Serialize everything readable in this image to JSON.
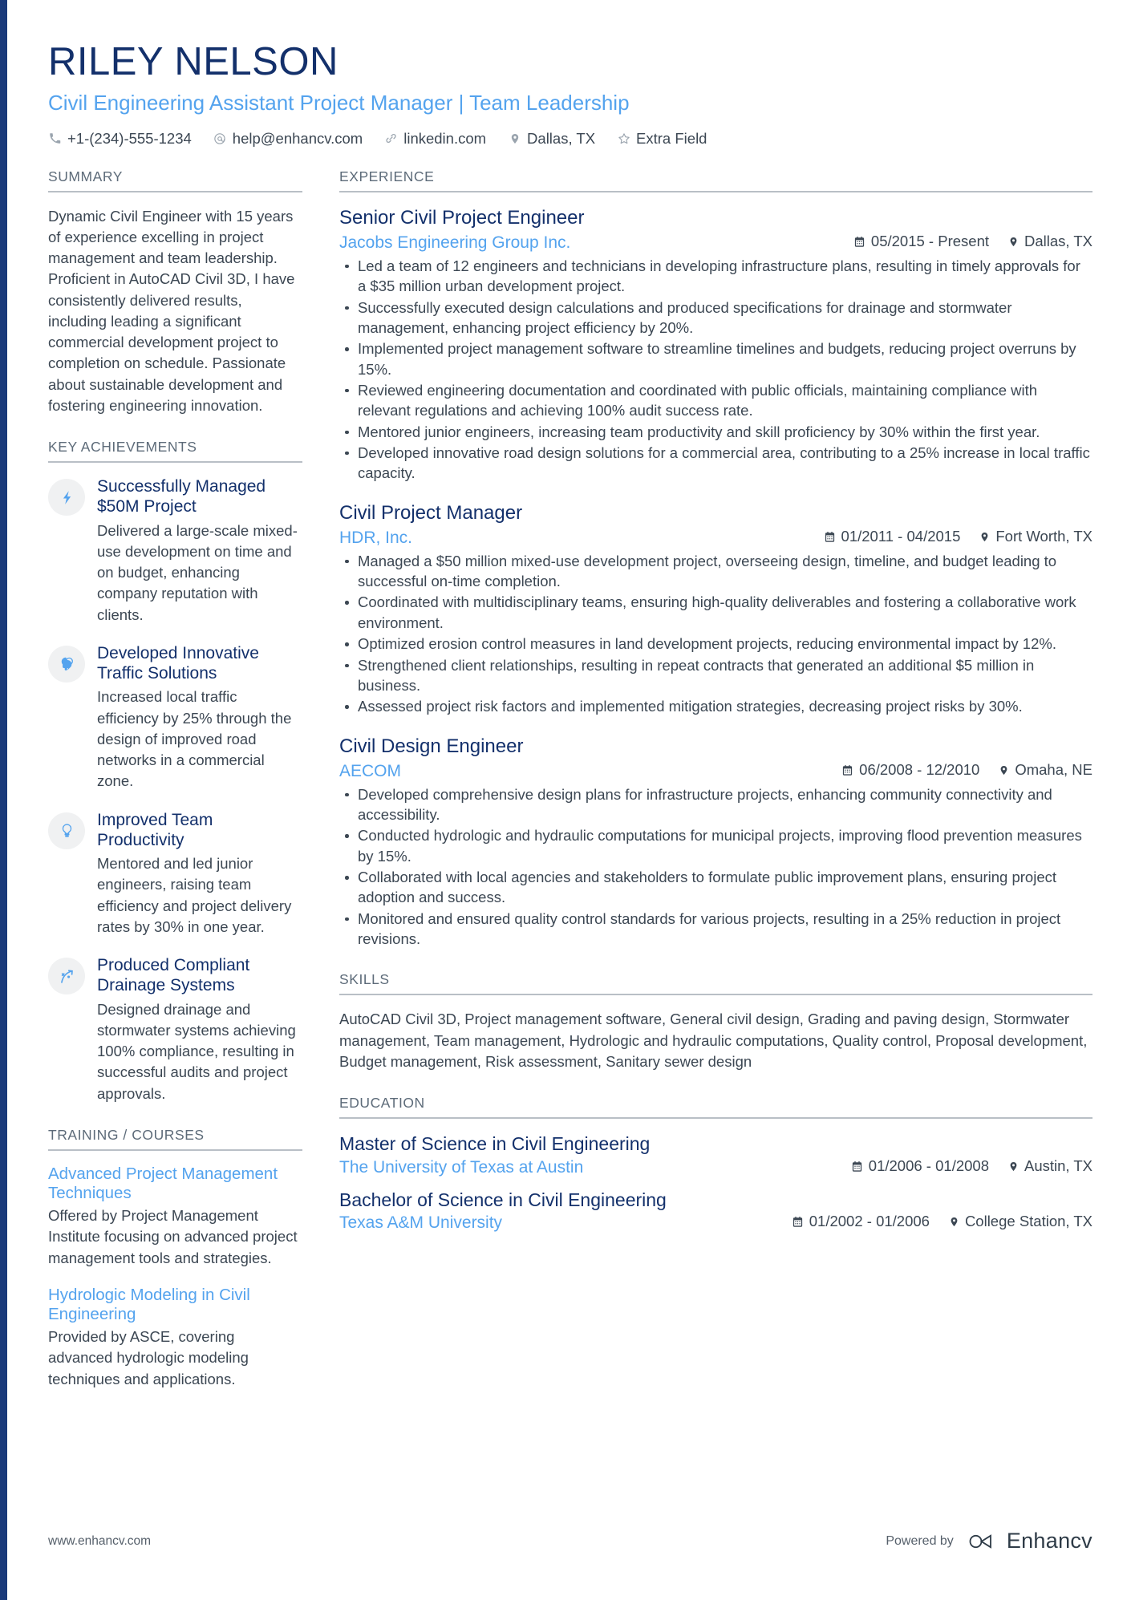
{
  "header": {
    "name": "RILEY NELSON",
    "headline": "Civil Engineering Assistant Project Manager | Team Leadership",
    "contacts": [
      {
        "icon": "phone-icon",
        "text": "+1-(234)-555-1234"
      },
      {
        "icon": "email-icon",
        "text": "help@enhancv.com"
      },
      {
        "icon": "link-icon",
        "text": "linkedin.com"
      },
      {
        "icon": "location-pin-icon",
        "text": "Dallas, TX"
      },
      {
        "icon": "star-icon",
        "text": "Extra Field"
      }
    ]
  },
  "summary": {
    "title": "SUMMARY",
    "text": "Dynamic Civil Engineer with 15 years of experience excelling in project management and team leadership. Proficient in AutoCAD Civil 3D, I have consistently delivered results, including leading a significant commercial development project to completion on schedule. Passionate about sustainable development and fostering engineering innovation."
  },
  "key_achievements": {
    "title": "KEY ACHIEVEMENTS",
    "items": [
      {
        "icon": "lightning-bolt-icon",
        "title": "Successfully Managed $50M Project",
        "description": "Delivered a large-scale mixed-use development on time and on budget, enhancing company reputation with clients."
      },
      {
        "icon": "head-idea-icon",
        "title": "Developed Innovative Traffic Solutions",
        "description": "Increased local traffic efficiency by 25% through the design of improved road networks in a commercial zone."
      },
      {
        "icon": "lightbulb-icon",
        "title": "Improved Team Productivity",
        "description": "Mentored and led junior engineers, raising team efficiency and project delivery rates by 30% in one year."
      },
      {
        "icon": "trend-arrow-icon",
        "title": "Produced Compliant Drainage Systems",
        "description": "Designed drainage and stormwater systems achieving 100% compliance, resulting in successful audits and project approvals."
      }
    ]
  },
  "training": {
    "title": "TRAINING / COURSES",
    "items": [
      {
        "title": "Advanced Project Management Techniques",
        "description": "Offered by Project Management Institute focusing on advanced project management tools and strategies."
      },
      {
        "title": "Hydrologic Modeling in Civil Engineering",
        "description": "Provided by ASCE, covering advanced hydrologic modeling techniques and applications."
      }
    ]
  },
  "experience": {
    "title": "EXPERIENCE",
    "jobs": [
      {
        "title": "Senior Civil Project Engineer",
        "company": "Jacobs Engineering Group Inc.",
        "dates": "05/2015 - Present",
        "location": "Dallas, TX",
        "bullets": [
          "Led a team of 12 engineers and technicians in developing infrastructure plans, resulting in timely approvals for a $35 million urban development project.",
          "Successfully executed design calculations and produced specifications for drainage and stormwater management, enhancing project efficiency by 20%.",
          "Implemented project management software to streamline timelines and budgets, reducing project overruns by 15%.",
          "Reviewed engineering documentation and coordinated with public officials, maintaining compliance with relevant regulations and achieving 100% audit success rate.",
          "Mentored junior engineers, increasing team productivity and skill proficiency by 30% within the first year.",
          "Developed innovative road design solutions for a commercial area, contributing to a 25% increase in local traffic capacity."
        ]
      },
      {
        "title": "Civil Project Manager",
        "company": "HDR, Inc.",
        "dates": "01/2011 - 04/2015",
        "location": "Fort Worth, TX",
        "bullets": [
          "Managed a $50 million mixed-use development project, overseeing design, timeline, and budget leading to successful on-time completion.",
          "Coordinated with multidisciplinary teams, ensuring high-quality deliverables and fostering a collaborative work environment.",
          "Optimized erosion control measures in land development projects, reducing environmental impact by 12%.",
          "Strengthened client relationships, resulting in repeat contracts that generated an additional $5 million in business.",
          "Assessed project risk factors and implemented mitigation strategies, decreasing project risks by 30%."
        ]
      },
      {
        "title": "Civil Design Engineer",
        "company": "AECOM",
        "dates": "06/2008 - 12/2010",
        "location": "Omaha, NE",
        "bullets": [
          "Developed comprehensive design plans for infrastructure projects, enhancing community connectivity and accessibility.",
          "Conducted hydrologic and hydraulic computations for municipal projects, improving flood prevention measures by 15%.",
          "Collaborated with local agencies and stakeholders to formulate public improvement plans, ensuring project adoption and success.",
          "Monitored and ensured quality control standards for various projects, resulting in a 25% reduction in project revisions."
        ]
      }
    ]
  },
  "skills": {
    "title": "SKILLS",
    "text": "AutoCAD Civil 3D, Project management software, General civil design, Grading and paving design, Stormwater management, Team management, Hydrologic and hydraulic computations, Quality control, Proposal development, Budget management, Risk assessment, Sanitary sewer design"
  },
  "education": {
    "title": "EDUCATION",
    "items": [
      {
        "degree": "Master of Science in Civil Engineering",
        "school": "The University of Texas at Austin",
        "dates": "01/2006 - 01/2008",
        "location": "Austin, TX"
      },
      {
        "degree": "Bachelor of Science in Civil Engineering",
        "school": "Texas A&M University",
        "dates": "01/2002 - 01/2006",
        "location": "College Station, TX"
      }
    ]
  },
  "footer": {
    "website": "www.enhancv.com",
    "powered_by": "Powered by",
    "brand": "Enhancv"
  },
  "colors": {
    "navy": "#13306b",
    "accent_blue": "#54a3ee",
    "body_text": "#3c4753",
    "muted": "#5d6b79",
    "rule": "#b9bfc6",
    "icon_bubble": "#f0f1f2",
    "sidebar_bar": "#1a3a7a"
  }
}
